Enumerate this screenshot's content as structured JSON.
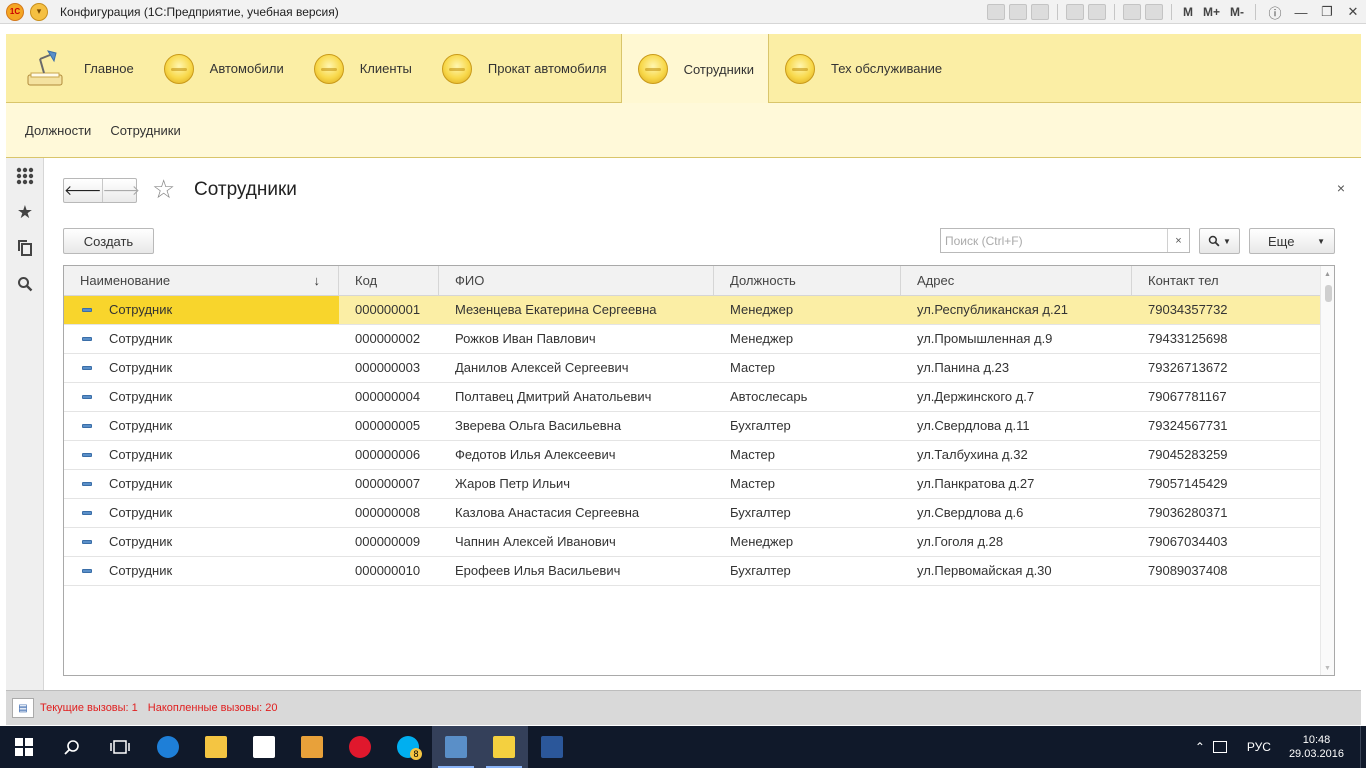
{
  "window": {
    "title": "Конфигурация  (1С:Предприятие, учебная версия)",
    "toolbar_text": [
      "M",
      "M+",
      "M-"
    ]
  },
  "sections": [
    {
      "label": "Главное",
      "icon": "desk-lamp-icon",
      "active": false
    },
    {
      "label": "Автомобили",
      "icon": "section-icon",
      "active": false
    },
    {
      "label": "Клиенты",
      "icon": "section-icon",
      "active": false
    },
    {
      "label": "Прокат автомобиля",
      "icon": "section-icon",
      "active": false
    },
    {
      "label": "Сотрудники",
      "icon": "section-icon",
      "active": true
    },
    {
      "label": "Тех обслуживание",
      "icon": "section-icon",
      "active": false
    }
  ],
  "nav_panel": {
    "links": [
      "Должности",
      "Сотрудники"
    ]
  },
  "form": {
    "title": "Сотрудники",
    "create_label": "Создать",
    "search_placeholder": "Поиск (Ctrl+F)",
    "search_clear": "×",
    "more_label": "Еще",
    "close": "×"
  },
  "table": {
    "columns": [
      "Наименование",
      "Код",
      "ФИО",
      "Должность",
      "Адрес",
      "Контакт тел"
    ],
    "sorted_column": "Наименование",
    "selected_row": 0,
    "rows": [
      [
        "Сотрудник",
        "000000001",
        "Мезенцева Екатерина Сергеевна",
        "Менеджер",
        "ул.Республиканская д.21",
        "79034357732"
      ],
      [
        "Сотрудник",
        "000000002",
        "Рожков Иван Павлович",
        "Менеджер",
        "ул.Промышленная д.9",
        "79433125698"
      ],
      [
        "Сотрудник",
        "000000003",
        "Данилов Алексей Сергеевич",
        "Мастер",
        "ул.Панина д.23",
        "79326713672"
      ],
      [
        "Сотрудник",
        "000000004",
        "Полтавец Дмитрий Анатольевич",
        "Автослесарь",
        "ул.Держинского д.7",
        "79067781167"
      ],
      [
        "Сотрудник",
        "000000005",
        "Зверева Ольга Васильевна",
        "Бухгалтер",
        "ул.Свердлова д.11",
        "79324567731"
      ],
      [
        "Сотрудник",
        "000000006",
        "Федотов Илья Алексеевич",
        "Мастер",
        "ул.Талбухина д.32",
        "79045283259"
      ],
      [
        "Сотрудник",
        "000000007",
        "Жаров Петр Ильич",
        "Мастер",
        "ул.Панкратова д.27",
        "79057145429"
      ],
      [
        "Сотрудник",
        "000000008",
        "Казлова Анастасия Сергеевна",
        "Бухгалтер",
        "ул.Свердлова д.6",
        "79036280371"
      ],
      [
        "Сотрудник",
        "000000009",
        "Чапнин Алексей Иванович",
        "Менеджер",
        "ул.Гоголя д.28",
        "79067034403"
      ],
      [
        "Сотрудник",
        "000000010",
        "Ерофеев Илья Васильевич",
        "Бухгалтер",
        "ул.Первомайская д.30",
        "79089037408"
      ]
    ]
  },
  "status": {
    "current_calls": "Текущие вызовы: 1",
    "accumulated_calls": "Накопленные вызовы: 20"
  },
  "taskbar": {
    "language": "РУС",
    "time": "10:48",
    "date": "29.03.2016",
    "skype_badge": "8"
  },
  "colors": {
    "section_bar": "#fbeea5",
    "selected_row": "#fbeea5",
    "selected_cell": "#f8d52c",
    "status_text": "#e02020"
  }
}
